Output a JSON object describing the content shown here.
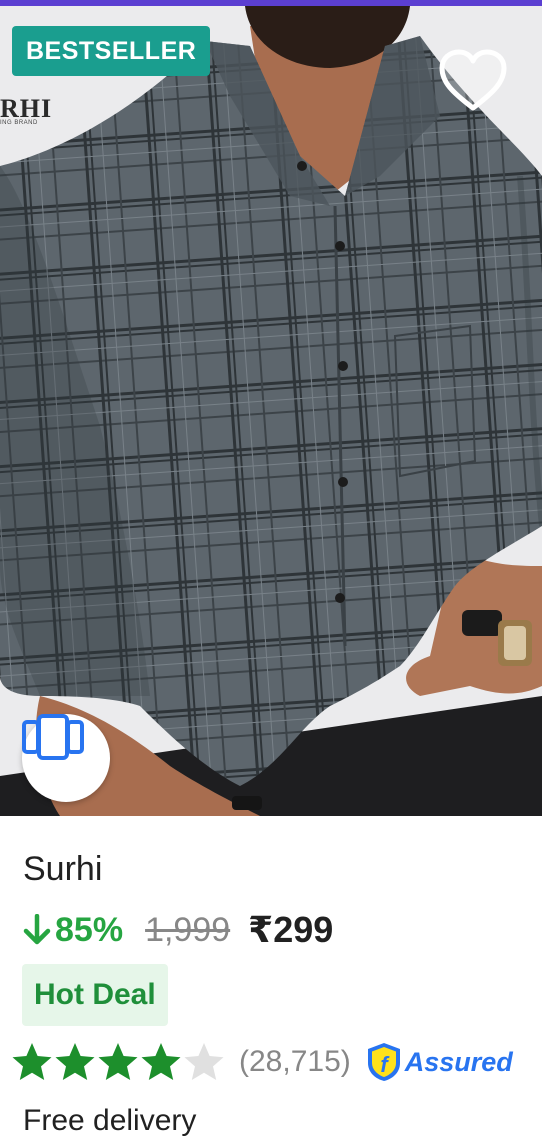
{
  "product": {
    "badge": "BESTSELLER",
    "brand_logo_text": "RHI",
    "brand_logo_subtext": "ING BRAND",
    "name": "Surhi",
    "discount_percent": "85%",
    "mrp": "1,999",
    "price": "₹299",
    "deal_tag": "Hot Deal",
    "rating_stars": 4,
    "rating_max": 5,
    "review_count": "(28,715)",
    "assured_label": "Assured",
    "delivery": "Free delivery"
  },
  "icons": {
    "wishlist": "heart-outline-icon",
    "similar": "similar-products-icon",
    "discount": "arrow-down-icon",
    "assured": "flipkart-assured-icon",
    "rating": "star-icon"
  },
  "colors": {
    "accent_strip": "#5b3fd1",
    "badge_bg": "#1a9e8f",
    "discount_green": "#26a541",
    "star_green": "#1d8f2c",
    "star_empty": "#e0e0e0",
    "hot_deal_bg": "#e6f6e9",
    "assured_blue": "#2874f0"
  }
}
